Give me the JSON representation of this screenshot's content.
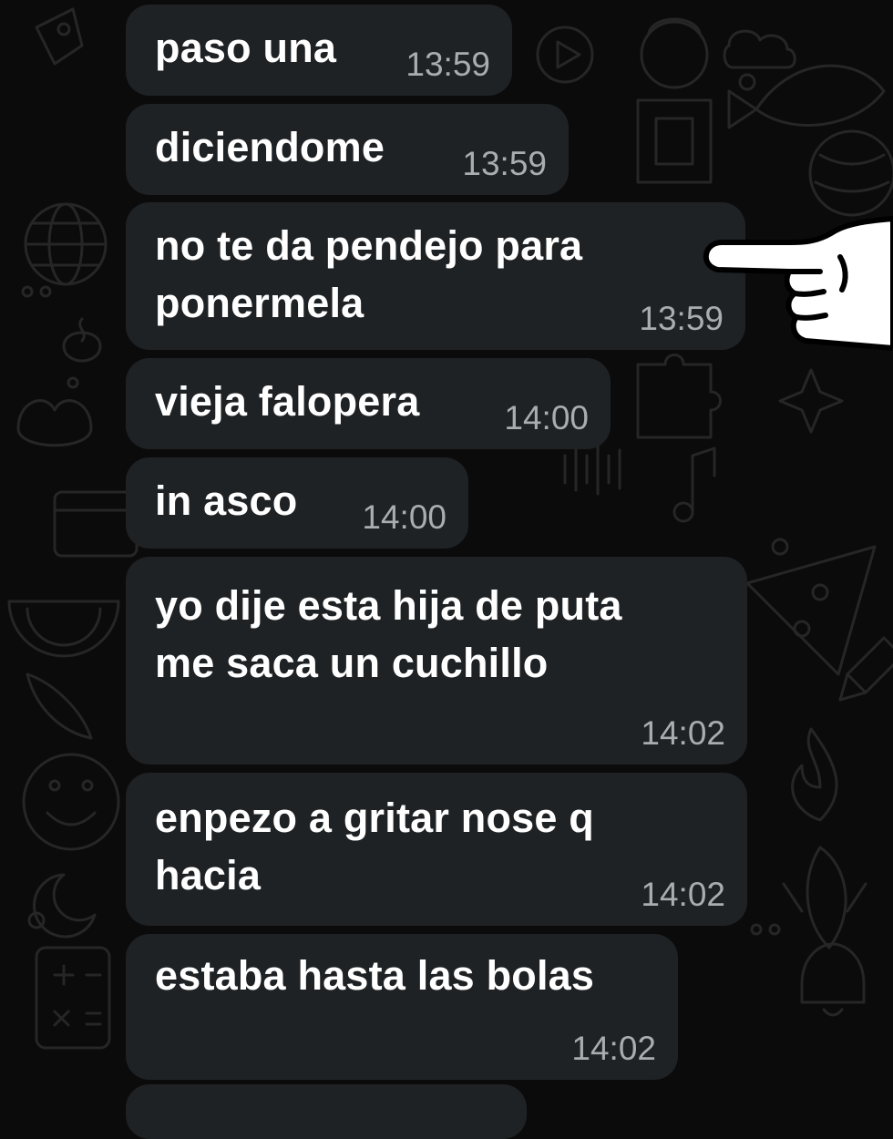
{
  "chat": {
    "messages": [
      {
        "text": "paso una",
        "time": "13:59"
      },
      {
        "text": "diciendome",
        "time": "13:59"
      },
      {
        "text": "no te da pendejo para\nponermela",
        "time": "13:59"
      },
      {
        "text": "vieja falopera",
        "time": "14:00"
      },
      {
        "text": "in asco",
        "time": "14:00"
      },
      {
        "text": "yo dije esta hija de puta\nme saca un cuchillo",
        "time": "14:02"
      },
      {
        "text": "enpezo a gritar nose q\nhacia",
        "time": "14:02"
      },
      {
        "text": "estaba hasta las bolas",
        "time": "14:02"
      }
    ]
  },
  "sticker": {
    "icon": "pointing-hand-icon"
  },
  "colors": {
    "bubble": "#1f2224",
    "background": "#0b0b0b",
    "timestamp": "#a9adb0",
    "text": "#ffffff"
  }
}
